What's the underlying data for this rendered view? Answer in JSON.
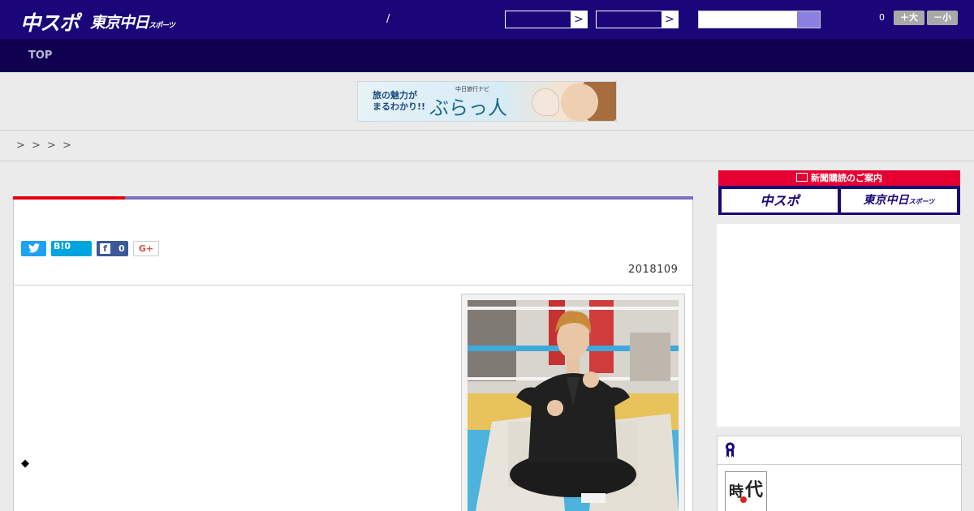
{
  "header": {
    "logo_chuspo": "中スポ",
    "logo_tokyo": "東京中日",
    "logo_tokyo_small": "スポーツ",
    "slash": "/",
    "select1_arrow": ">",
    "select2_arrow": ">",
    "font_count": "0",
    "font_larger": "＋大",
    "font_smaller": "－小"
  },
  "nav": {
    "top_label": "TOP"
  },
  "banner": {
    "line1": "旅の魅力が",
    "line2": "まるわかり!!",
    "sub": "中日旅行ナビ",
    "logo": "ぶらっ人"
  },
  "breadcrumb": [
    ">",
    ">",
    ">",
    ">"
  ],
  "article": {
    "share_twitter_icon": "twitter-icon",
    "share_hatena": "B!0",
    "share_facebook_count": "0",
    "share_gplus": "G+",
    "date": "2018109",
    "bullet": "◆"
  },
  "sidebar": {
    "subscribe_title": "新聞購読のご案内",
    "subscribe_chuspo": "中スポ",
    "subscribe_tokyo": "東京中日",
    "subscribe_tokyo_small": "スポーツ",
    "ranking_icon": "medal-icon",
    "ranking_thumb_text1": "時",
    "ranking_thumb_text2": "代"
  },
  "colors": {
    "header_bg": "#1a0678",
    "nav_bg": "#100050",
    "accent_red": "#e60012",
    "accent_purple": "#7d6ec4",
    "twitter": "#1da1f2",
    "hatena": "#00a4de",
    "facebook": "#3b5998"
  }
}
